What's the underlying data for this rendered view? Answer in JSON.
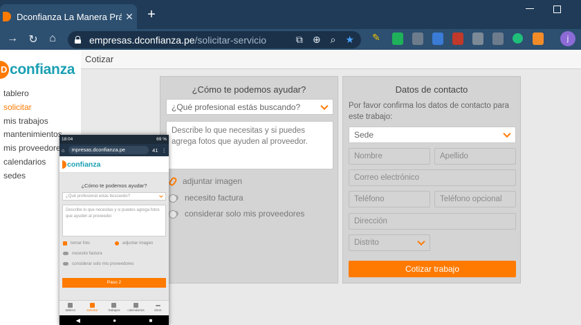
{
  "browser": {
    "tab_title": "Dconfianza La Manera Práctica D",
    "tab_close": "✕",
    "new_tab": "+",
    "url_host": "empresas.dconfianza.pe",
    "url_path": "/solicitar-servicio",
    "profile_initial": "j",
    "accent_color": "#4aa3ff"
  },
  "brand": {
    "logo_letter": "D",
    "logo_text": "confianza",
    "primary_color": "#ff7a00",
    "secondary_color": "#1a9fb3"
  },
  "sidebar": {
    "items": [
      {
        "label": "tablero"
      },
      {
        "label": "solicitar"
      },
      {
        "label": "mis trabajos"
      },
      {
        "label": "mantenimientos"
      },
      {
        "label": "mis proveedores"
      },
      {
        "label": "calendarios"
      },
      {
        "label": "sedes"
      }
    ],
    "active_index": 1
  },
  "topbar": {
    "title": "Cotizar"
  },
  "help_card": {
    "title": "¿Cómo te podemos ayudar?",
    "professional_select": "¿Qué profesional estás buscando?",
    "description_placeholder": "Describe lo que necesitas y si puedes agrega fotos que ayuden al proveedor.",
    "attach_label": "adjuntar imagen",
    "invoice_label": "necesito factura",
    "own_providers_label": "considerar solo mis proveedores"
  },
  "contact_card": {
    "title": "Datos de contacto",
    "instructions": "Por favor confirma los datos de contacto para este trabajo:",
    "sede_select": "Sede",
    "first_name_placeholder": "Nombre",
    "last_name_placeholder": "Apellido",
    "email_placeholder": "Correo electrónico",
    "phone_placeholder": "Teléfono",
    "phone_optional_placeholder": "Teléfono opcional",
    "address_placeholder": "Dirección",
    "district_select": "Distrito",
    "submit_label": "Cotizar trabajo"
  },
  "phone": {
    "status_time": "18:04",
    "status_right": "69 %",
    "url": "mpresas.dconfianza.pe",
    "tab_count": "41",
    "title": "¿Cómo te podemos ayudar?",
    "select_placeholder": "¿Qué profesional estás buscando?",
    "textarea_placeholder": "Describe lo que necesitas y si puedes agrega fotos que ayuden al proveedor.",
    "take_photo": "tomar foto",
    "attach_image": "adjuntar imagen",
    "invoice": "necesito factura",
    "own_providers": "considerar solo mis proveedores",
    "next_button": "Paso 2",
    "nav": [
      {
        "label": "tablero"
      },
      {
        "label": "solicitar"
      },
      {
        "label": "trabajos"
      },
      {
        "label": "calendarios"
      },
      {
        "label": "otros"
      }
    ]
  }
}
